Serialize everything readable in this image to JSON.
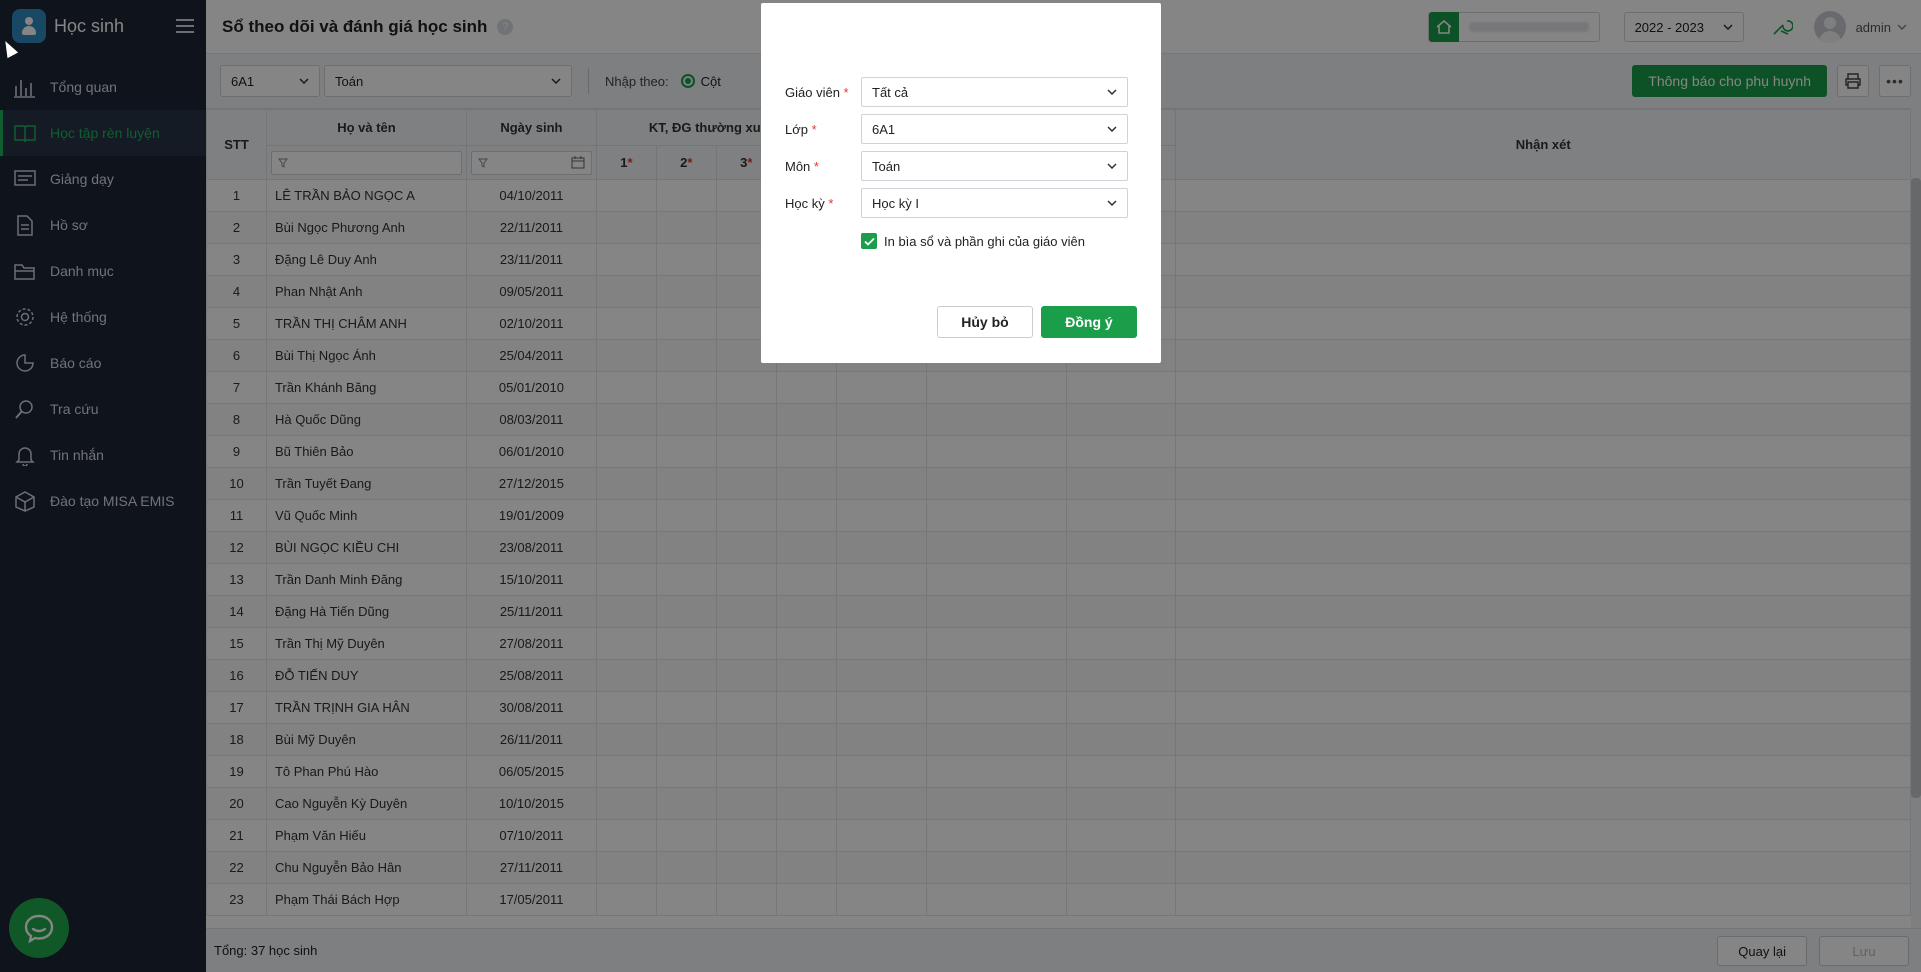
{
  "app": {
    "title": "Học sinh"
  },
  "sidebar": {
    "items": [
      {
        "label": "Tổng quan",
        "icon": "bar-chart-icon"
      },
      {
        "label": "Học tập rèn luyện",
        "icon": "book-icon",
        "active": true
      },
      {
        "label": "Giảng dạy",
        "icon": "board-icon"
      },
      {
        "label": "Hồ sơ",
        "icon": "document-icon"
      },
      {
        "label": "Danh mục",
        "icon": "folder-icon"
      },
      {
        "label": "Hệ thống",
        "icon": "gear-icon"
      },
      {
        "label": "Báo cáo",
        "icon": "pie-icon"
      },
      {
        "label": "Tra cứu",
        "icon": "search-icon"
      },
      {
        "label": "Tin nhắn",
        "icon": "bell-icon"
      },
      {
        "label": "Đào tạo MISA EMIS",
        "icon": "cube-icon"
      }
    ]
  },
  "header": {
    "page_title": "Sổ theo dõi và đánh giá học sinh",
    "help": "?",
    "school_year": "2022 - 2023",
    "user": "admin"
  },
  "filters": {
    "class": "6A1",
    "subject": "Toán",
    "input_mode_label": "Nhập theo:",
    "input_mode_value": "Cột",
    "notify_button": "Thông báo cho phụ huynh"
  },
  "table": {
    "headers": {
      "stt": "STT",
      "name": "Họ và tên",
      "dob": "Ngày sinh",
      "group": "KT, ĐG thường xu",
      "c1": "1",
      "c2": "2",
      "c3": "3",
      "comment": "Nhận xét"
    },
    "rows": [
      {
        "stt": "1",
        "name": "LÊ TRẦN BẢO NGỌC A",
        "dob": "04/10/2011"
      },
      {
        "stt": "2",
        "name": "Bùi Ngọc Phương Anh",
        "dob": "22/11/2011"
      },
      {
        "stt": "3",
        "name": "Đặng Lê Duy Anh",
        "dob": "23/11/2011"
      },
      {
        "stt": "4",
        "name": "Phan Nhật Anh",
        "dob": "09/05/2011"
      },
      {
        "stt": "5",
        "name": "TRẦN THỊ CHÂM ANH",
        "dob": "02/10/2011"
      },
      {
        "stt": "6",
        "name": "Bùi Thị Ngọc Ánh",
        "dob": "25/04/2011"
      },
      {
        "stt": "7",
        "name": "Trần Khánh Băng",
        "dob": "05/01/2010"
      },
      {
        "stt": "8",
        "name": "Hà Quốc Dũng",
        "dob": "08/03/2011"
      },
      {
        "stt": "9",
        "name": "Bũ Thiên Bảo",
        "dob": "06/01/2010"
      },
      {
        "stt": "10",
        "name": "Trần Tuyết Đang",
        "dob": "27/12/2015"
      },
      {
        "stt": "11",
        "name": "Vũ Quốc Minh",
        "dob": "19/01/2009"
      },
      {
        "stt": "12",
        "name": "BÙI NGỌC KIỀU CHI",
        "dob": "23/08/2011"
      },
      {
        "stt": "13",
        "name": "Trần Danh Minh Đăng",
        "dob": "15/10/2011"
      },
      {
        "stt": "14",
        "name": "Đặng Hà Tiến Dũng",
        "dob": "25/11/2011"
      },
      {
        "stt": "15",
        "name": "Trần Thị Mỹ Duyên",
        "dob": "27/08/2011"
      },
      {
        "stt": "16",
        "name": "ĐỖ TIẾN DUY",
        "dob": "25/08/2011"
      },
      {
        "stt": "17",
        "name": "TRẦN TRỊNH GIA HÂN",
        "dob": "30/08/2011"
      },
      {
        "stt": "18",
        "name": "Bùi Mỹ Duyên",
        "dob": "26/11/2011"
      },
      {
        "stt": "19",
        "name": "Tô Phan Phú Hào",
        "dob": "06/05/2015"
      },
      {
        "stt": "20",
        "name": "Cao Nguyễn Kỳ Duyên",
        "dob": "10/10/2015"
      },
      {
        "stt": "21",
        "name": "Phạm Văn Hiếu",
        "dob": "07/10/2011"
      },
      {
        "stt": "22",
        "name": "Chu Nguyễn Bảo Hân",
        "dob": "27/11/2011"
      },
      {
        "stt": "23",
        "name": "Phạm Thái Bách Hợp",
        "dob": "17/05/2011"
      }
    ]
  },
  "footer": {
    "total": "Tổng: 37 học sinh",
    "back_button": "Quay lại",
    "save_button": "Lưu"
  },
  "dialog": {
    "teacher_label": "Giáo viên",
    "teacher_value": "Tất cả",
    "class_label": "Lớp",
    "class_value": "6A1",
    "subject_label": "Môn",
    "subject_value": "Toán",
    "semester_label": "Học kỳ",
    "semester_value": "Học kỳ I",
    "required_mark": "*",
    "checkbox_label": "In bìa sổ và phần ghi của giáo viên",
    "cancel_button": "Hủy bỏ",
    "ok_button": "Đồng ý"
  },
  "colors": {
    "sidebar_bg": "#1d2736",
    "accent_green": "#1a9e4a",
    "active_text": "#1fb55a"
  }
}
